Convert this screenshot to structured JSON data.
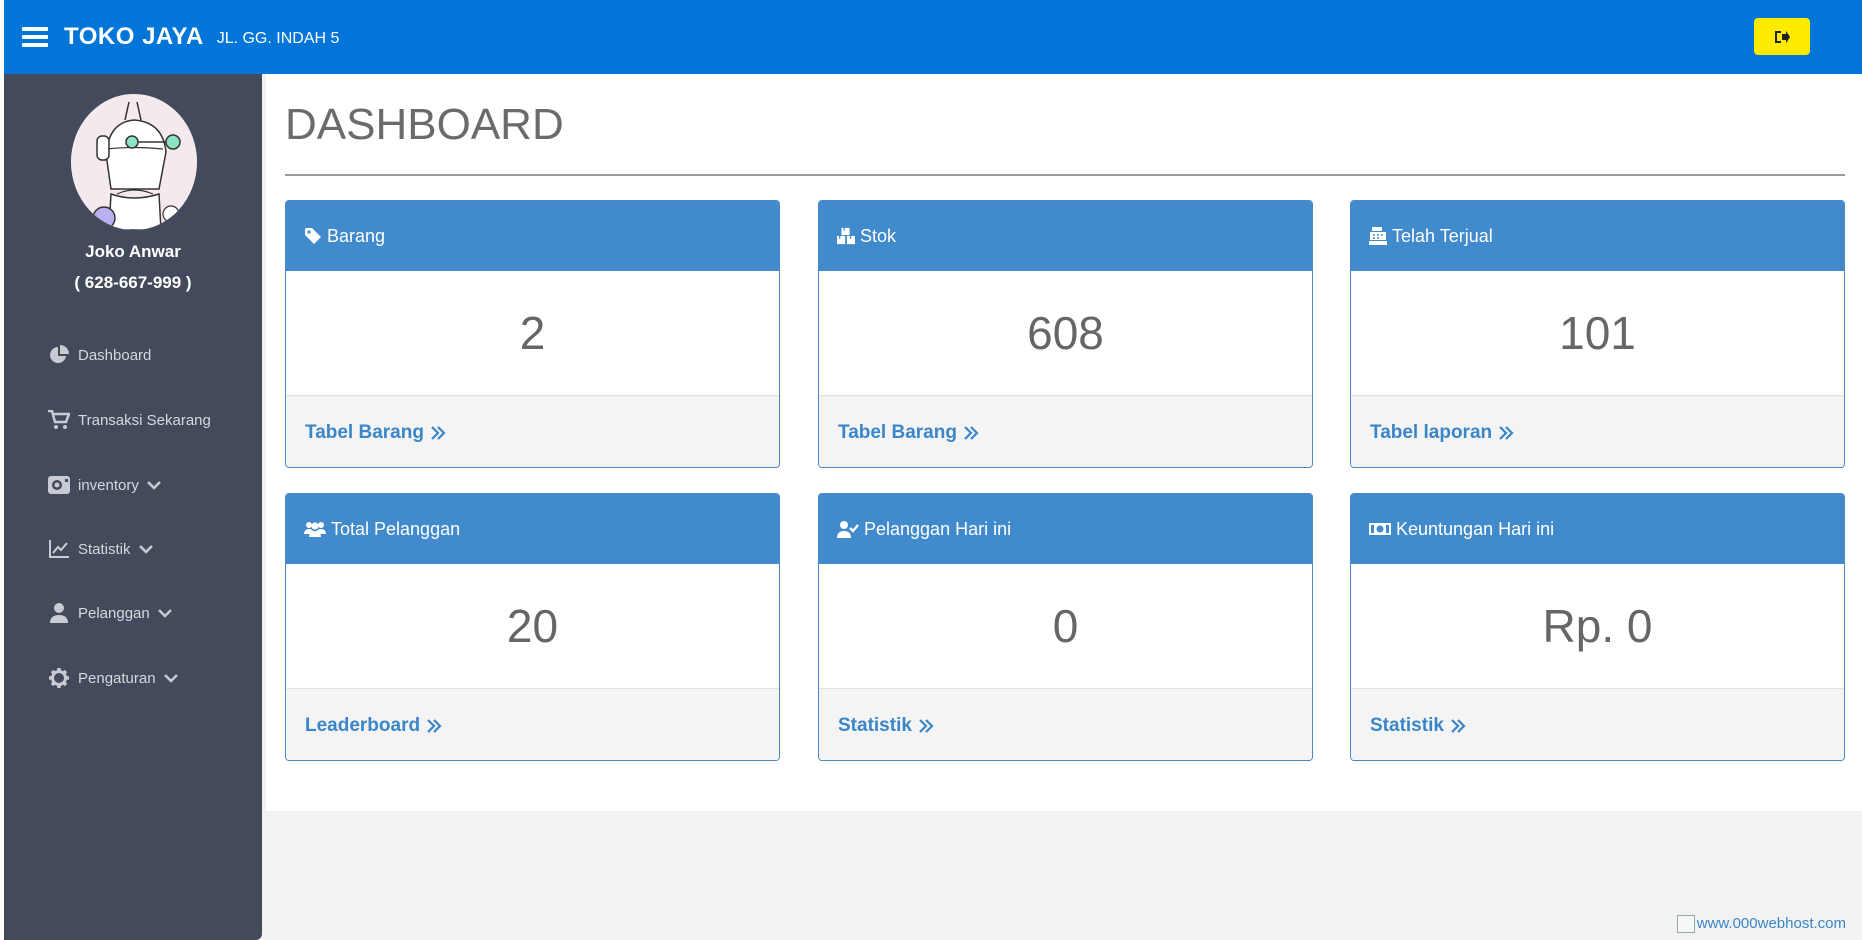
{
  "topbar": {
    "brand": "TOKO JAYA",
    "address": "JL. GG. INDAH 5",
    "logout_icon": "sign-out-icon",
    "colors": {
      "bar": "#0275d8",
      "logout_button": "#ffeb00"
    }
  },
  "sidebar": {
    "user_name": "Joko Anwar",
    "user_phone": "( 628-667-999 )",
    "items": [
      {
        "label": "Dashboard",
        "icon": "pie-chart-icon",
        "has_submenu": false
      },
      {
        "label": "Transaksi Sekarang",
        "icon": "cart-icon",
        "has_submenu": false
      },
      {
        "label": "inventory",
        "icon": "inventory-icon",
        "has_submenu": true
      },
      {
        "label": "Statistik",
        "icon": "line-chart-icon",
        "has_submenu": true
      },
      {
        "label": "Pelanggan",
        "icon": "user-icon",
        "has_submenu": true
      },
      {
        "label": "Pengaturan",
        "icon": "gear-icon",
        "has_submenu": true
      }
    ]
  },
  "main": {
    "title": "DASHBOARD",
    "cards": [
      {
        "title": "Barang",
        "icon": "tag-icon",
        "value": "2",
        "link": "Tabel Barang"
      },
      {
        "title": "Stok",
        "icon": "boxes-icon",
        "value": "608",
        "link": "Tabel Barang"
      },
      {
        "title": "Telah Terjual",
        "icon": "cash-register-icon",
        "value": "101",
        "link": "Tabel laporan"
      },
      {
        "title": "Total Pelanggan",
        "icon": "users-icon",
        "value": "20",
        "link": "Leaderboard"
      },
      {
        "title": "Pelanggan Hari ini",
        "icon": "user-check-icon",
        "value": "0",
        "link": "Statistik"
      },
      {
        "title": "Keuntungan Hari ini",
        "icon": "money-bill-icon",
        "value": "Rp. 0",
        "link": "Statistik"
      }
    ]
  },
  "footer": {
    "webhost_alt": "www.000webhost.com"
  }
}
